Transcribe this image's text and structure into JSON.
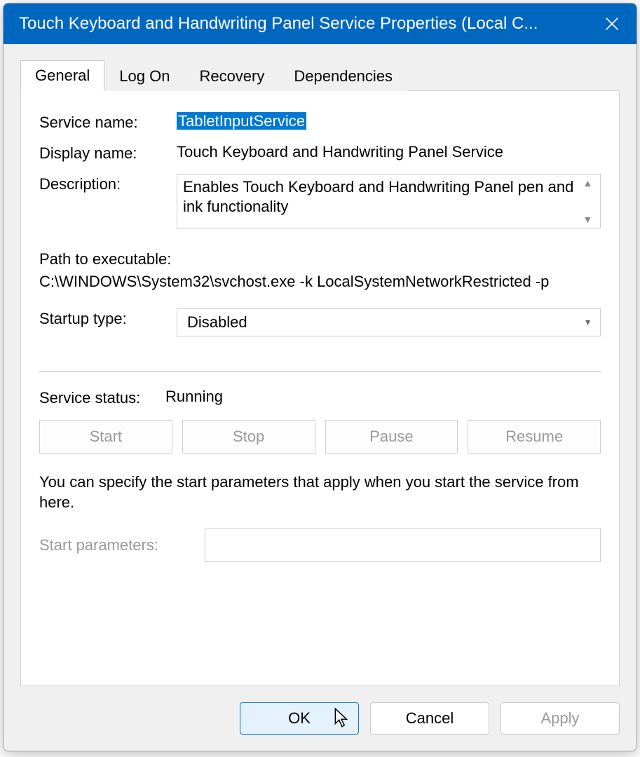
{
  "window": {
    "title": "Touch Keyboard and Handwriting Panel Service Properties (Local C..."
  },
  "tabs": {
    "general": "General",
    "logon": "Log On",
    "recovery": "Recovery",
    "dependencies": "Dependencies"
  },
  "labels": {
    "service_name": "Service name:",
    "display_name": "Display name:",
    "description": "Description:",
    "path_label": "Path to executable:",
    "startup_type": "Startup type:",
    "service_status": "Service status:",
    "start_params": "Start parameters:"
  },
  "values": {
    "service_name": "TabletInputService",
    "display_name": "Touch Keyboard and Handwriting Panel Service",
    "description": "Enables Touch Keyboard and Handwriting Panel pen and ink functionality",
    "path": "C:\\WINDOWS\\System32\\svchost.exe -k LocalSystemNetworkRestricted -p",
    "startup_type": "Disabled",
    "service_status": "Running",
    "hint": "You can specify the start parameters that apply when you start the service from here.",
    "start_params": ""
  },
  "buttons": {
    "start": "Start",
    "stop": "Stop",
    "pause": "Pause",
    "resume": "Resume",
    "ok": "OK",
    "cancel": "Cancel",
    "apply": "Apply"
  }
}
